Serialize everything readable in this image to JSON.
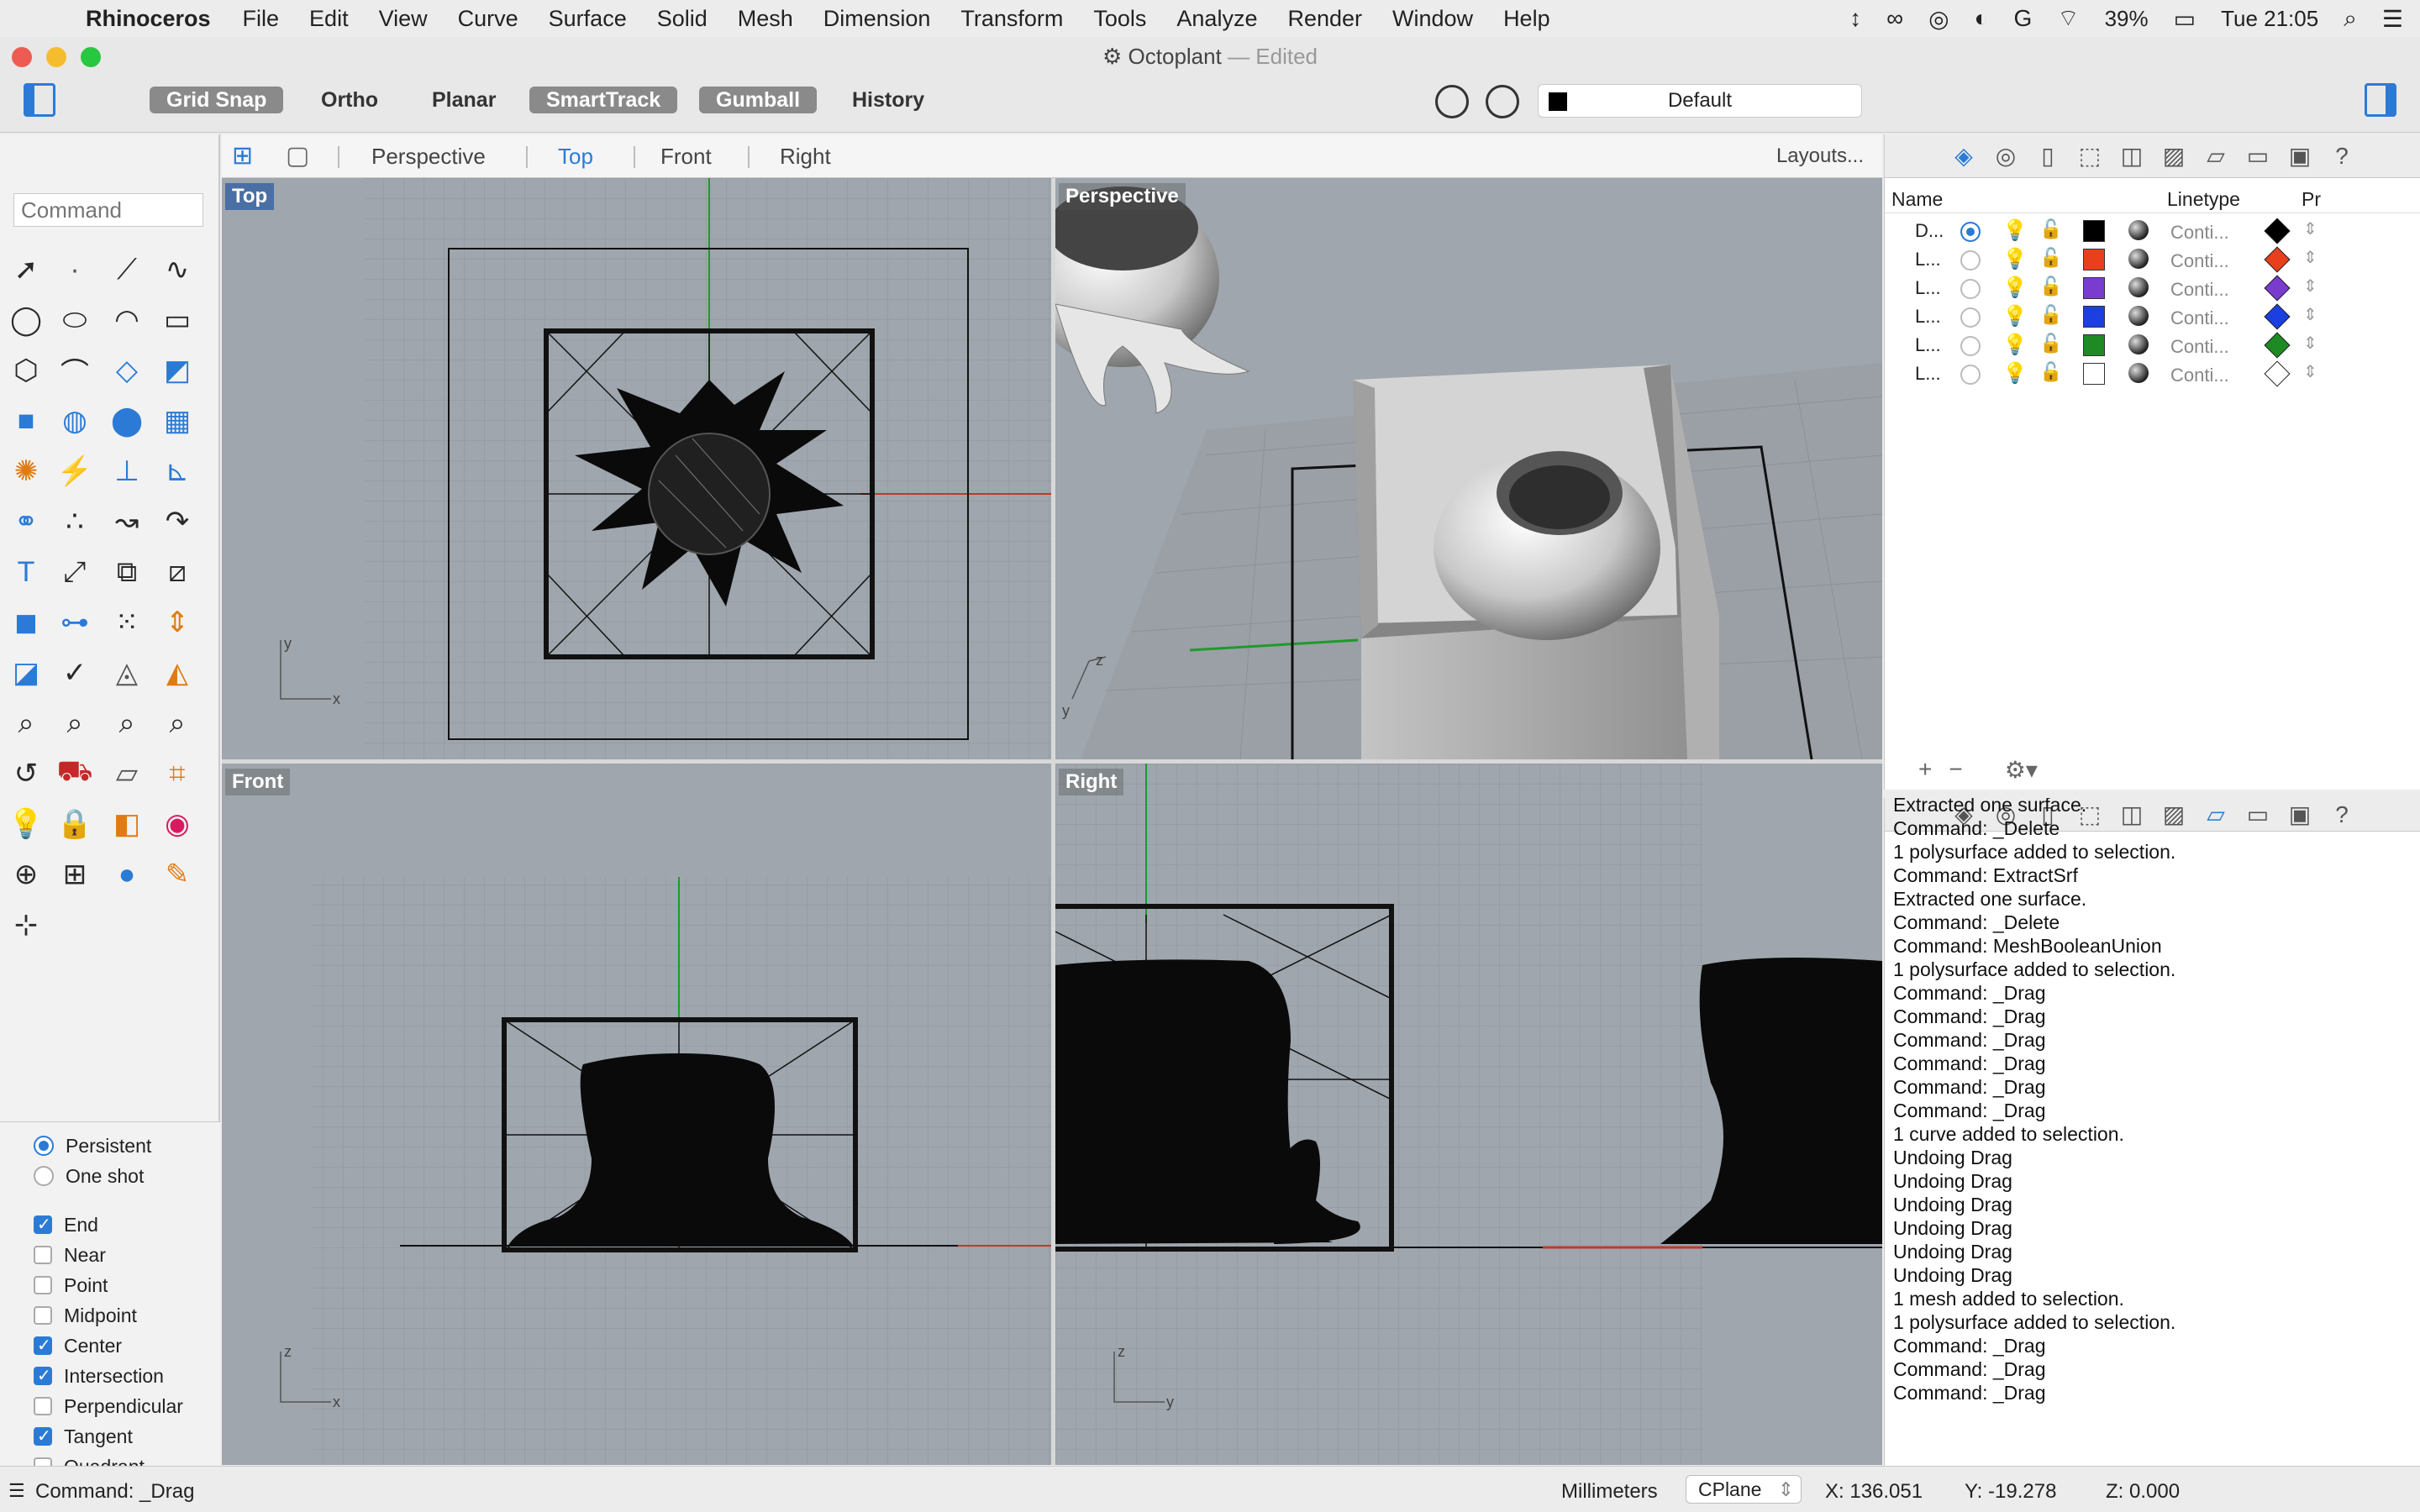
{
  "menubar": {
    "app_name": "Rhinoceros",
    "items": [
      "File",
      "Edit",
      "View",
      "Curve",
      "Surface",
      "Solid",
      "Mesh",
      "Dimension",
      "Transform",
      "Tools",
      "Analyze",
      "Render",
      "Window",
      "Help"
    ],
    "battery": "39%",
    "clock": "Tue 21:05"
  },
  "window": {
    "title": "Octoplant",
    "edited": "— Edited"
  },
  "toolbar": {
    "grid_snap": "Grid Snap",
    "ortho": "Ortho",
    "planar": "Planar",
    "smarttrack": "SmartTrack",
    "gumball": "Gumball",
    "history": "History",
    "layer_value": "Default",
    "layer_color": "#000000"
  },
  "viewtabs": {
    "tabs": [
      "Perspective",
      "Top",
      "Front",
      "Right"
    ],
    "active": "Top",
    "layouts": "Layouts..."
  },
  "command": {
    "placeholder": "Command"
  },
  "viewports": {
    "top": "Top",
    "perspective": "Perspective",
    "front": "Front",
    "right": "Right"
  },
  "osnap": {
    "persistent": "Persistent",
    "one_shot": "One shot",
    "items": [
      {
        "label": "End",
        "checked": true
      },
      {
        "label": "Near",
        "checked": false
      },
      {
        "label": "Point",
        "checked": false
      },
      {
        "label": "Midpoint",
        "checked": false
      },
      {
        "label": "Center",
        "checked": true
      },
      {
        "label": "Intersection",
        "checked": true
      },
      {
        "label": "Perpendicular",
        "checked": false
      },
      {
        "label": "Tangent",
        "checked": true
      },
      {
        "label": "Quadrant",
        "checked": false
      }
    ]
  },
  "layers": {
    "header_name": "Name",
    "header_linetype": "Linetype",
    "header_print": "Pr",
    "rows": [
      {
        "name": "D...",
        "current": true,
        "color": "#000000",
        "linetype": "Conti...",
        "print_color": "#000000"
      },
      {
        "name": "L...",
        "current": false,
        "color": "#e8401c",
        "linetype": "Conti...",
        "print_color": "#e8401c"
      },
      {
        "name": "L...",
        "current": false,
        "color": "#7a3ccf",
        "linetype": "Conti...",
        "print_color": "#7a3ccf"
      },
      {
        "name": "L...",
        "current": false,
        "color": "#1b3fe0",
        "linetype": "Conti...",
        "print_color": "#1b3fe0"
      },
      {
        "name": "L...",
        "current": false,
        "color": "#1e8a24",
        "linetype": "Conti...",
        "print_color": "#1e8a24"
      },
      {
        "name": "L...",
        "current": false,
        "color": "#ffffff",
        "linetype": "Conti...",
        "print_color": "#ffffff"
      }
    ]
  },
  "history": {
    "lines": [
      "Extracted one surface.",
      "Command: _Delete",
      "1 polysurface added to selection.",
      "Command: ExtractSrf",
      "Extracted one surface.",
      "Command: _Delete",
      "Command: MeshBooleanUnion",
      "1 polysurface added to selection.",
      "Command: _Drag",
      "Command: _Drag",
      "Command: _Drag",
      "Command: _Drag",
      "Command: _Drag",
      "Command: _Drag",
      "1 curve added to selection.",
      "Undoing Drag",
      "Undoing Drag",
      "Undoing Drag",
      "Undoing Drag",
      "Undoing Drag",
      "Undoing Drag",
      "1 mesh added to selection.",
      "1 polysurface added to selection.",
      "Command: _Drag",
      "Command: _Drag",
      "Command: _Drag"
    ]
  },
  "status": {
    "last_command": "Command: _Drag",
    "units": "Millimeters",
    "cplane": "CPlane",
    "x": "X: 136.051",
    "y": "Y: -19.278",
    "z": "Z: 0.000"
  }
}
